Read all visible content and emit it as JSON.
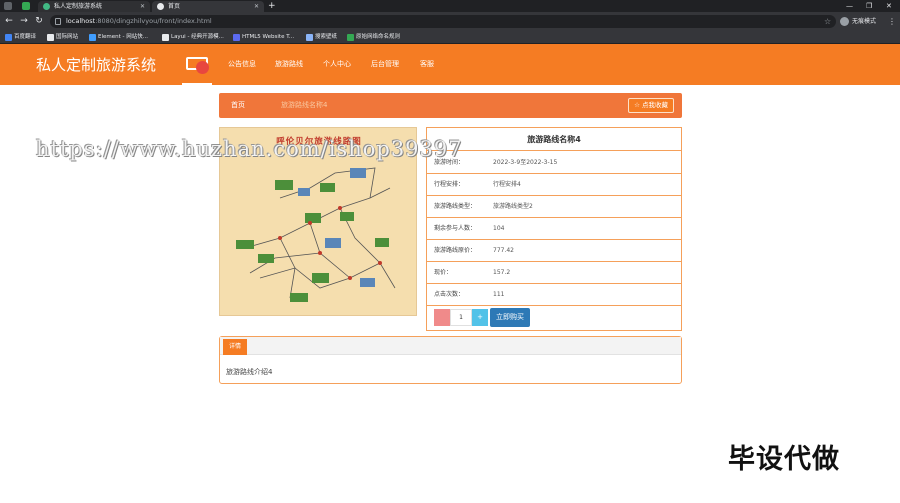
{
  "browser": {
    "tabs": [
      {
        "label": "私人定制旅游系统",
        "active": false,
        "favicon_color": "#41b883"
      },
      {
        "label": "首页",
        "active": true,
        "favicon_color": "#e8eaed"
      }
    ],
    "new_tab_label": "+",
    "window_controls": {
      "minimize": "—",
      "maximize": "❐",
      "close": "✕"
    },
    "url_host": "localhost",
    "url_rest": ":8080/dingzhilvyou/front/index.html",
    "profile_label": "无痕模式",
    "bookmarks": [
      {
        "label": "百度翻译",
        "color": "#4285f4"
      },
      {
        "label": "国际网站",
        "color": "#e8eaed"
      },
      {
        "label": "Element - 网站快...",
        "color": "#409eff"
      },
      {
        "label": "Layui - 经典开源模...",
        "color": "#e8eaed"
      },
      {
        "label": "HTML5 Website T...",
        "color": "#5b6af0"
      },
      {
        "label": "搜索壁纸",
        "color": "#8ab4f8"
      },
      {
        "label": "原始网络命名规则",
        "color": "#34a853"
      }
    ]
  },
  "header": {
    "title": "私人定制旅游系统",
    "nav": [
      "公告信息",
      "旅游路线",
      "个人中心",
      "后台管理",
      "客服"
    ]
  },
  "breadcrumb": {
    "home": "首页",
    "current": "旅游路线名称4",
    "favorite_label": "☆ 点我收藏"
  },
  "map": {
    "title": "呼伦贝尔旅游线路图"
  },
  "detail_info": {
    "title": "旅游路线名称4",
    "rows": [
      {
        "key": "旅游时间：",
        "value": "2022-3-9至2022-3-15"
      },
      {
        "key": "行程安排：",
        "value": "行程安排4"
      },
      {
        "key": "旅游路线类型：",
        "value": "旅游路线类型2"
      },
      {
        "key": "剩余参与人数：",
        "value": "104"
      },
      {
        "key": "旅游路线原价：",
        "value": "777.42"
      },
      {
        "key": "现价：",
        "value": "157.2"
      },
      {
        "key": "点击次数：",
        "value": "111"
      }
    ],
    "quantity": "1",
    "plus_label": "+",
    "buy_label": "立即购买"
  },
  "detail_panel": {
    "tab_label": "详情",
    "body": "旅游路线介绍4"
  },
  "watermarks": {
    "url": "https://www.huzhan.com/ishop39397",
    "corner": "毕设代做"
  },
  "colors": {
    "brand": "#f57c23",
    "buy": "#2d79b6",
    "plus": "#52c2e8",
    "minus": "#f08a8a"
  }
}
